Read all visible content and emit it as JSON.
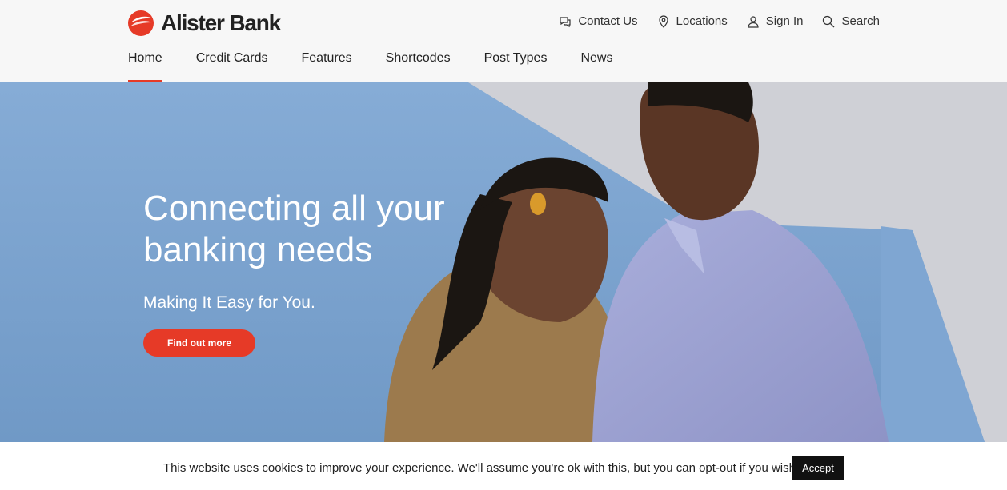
{
  "brand": {
    "name": "Alister Bank",
    "accent": "#e63a27"
  },
  "utility_nav": [
    {
      "label": "Contact Us",
      "icon": "chat-icon"
    },
    {
      "label": "Locations",
      "icon": "map-pin-icon"
    },
    {
      "label": "Sign In",
      "icon": "user-icon"
    },
    {
      "label": "Search",
      "icon": "search-icon"
    }
  ],
  "main_nav": [
    {
      "label": "Home",
      "active": true
    },
    {
      "label": "Credit Cards"
    },
    {
      "label": "Features"
    },
    {
      "label": "Shortcodes"
    },
    {
      "label": "Post Types"
    },
    {
      "label": "News"
    }
  ],
  "hero": {
    "title": "Connecting all your banking needs",
    "subtitle": "Making It Easy for You.",
    "cta": "Find out more"
  },
  "cookie": {
    "message": "This website uses cookies to improve your experience. We'll assume you're ok with this, but you can opt-out if you wish.",
    "accept": "Accept"
  }
}
